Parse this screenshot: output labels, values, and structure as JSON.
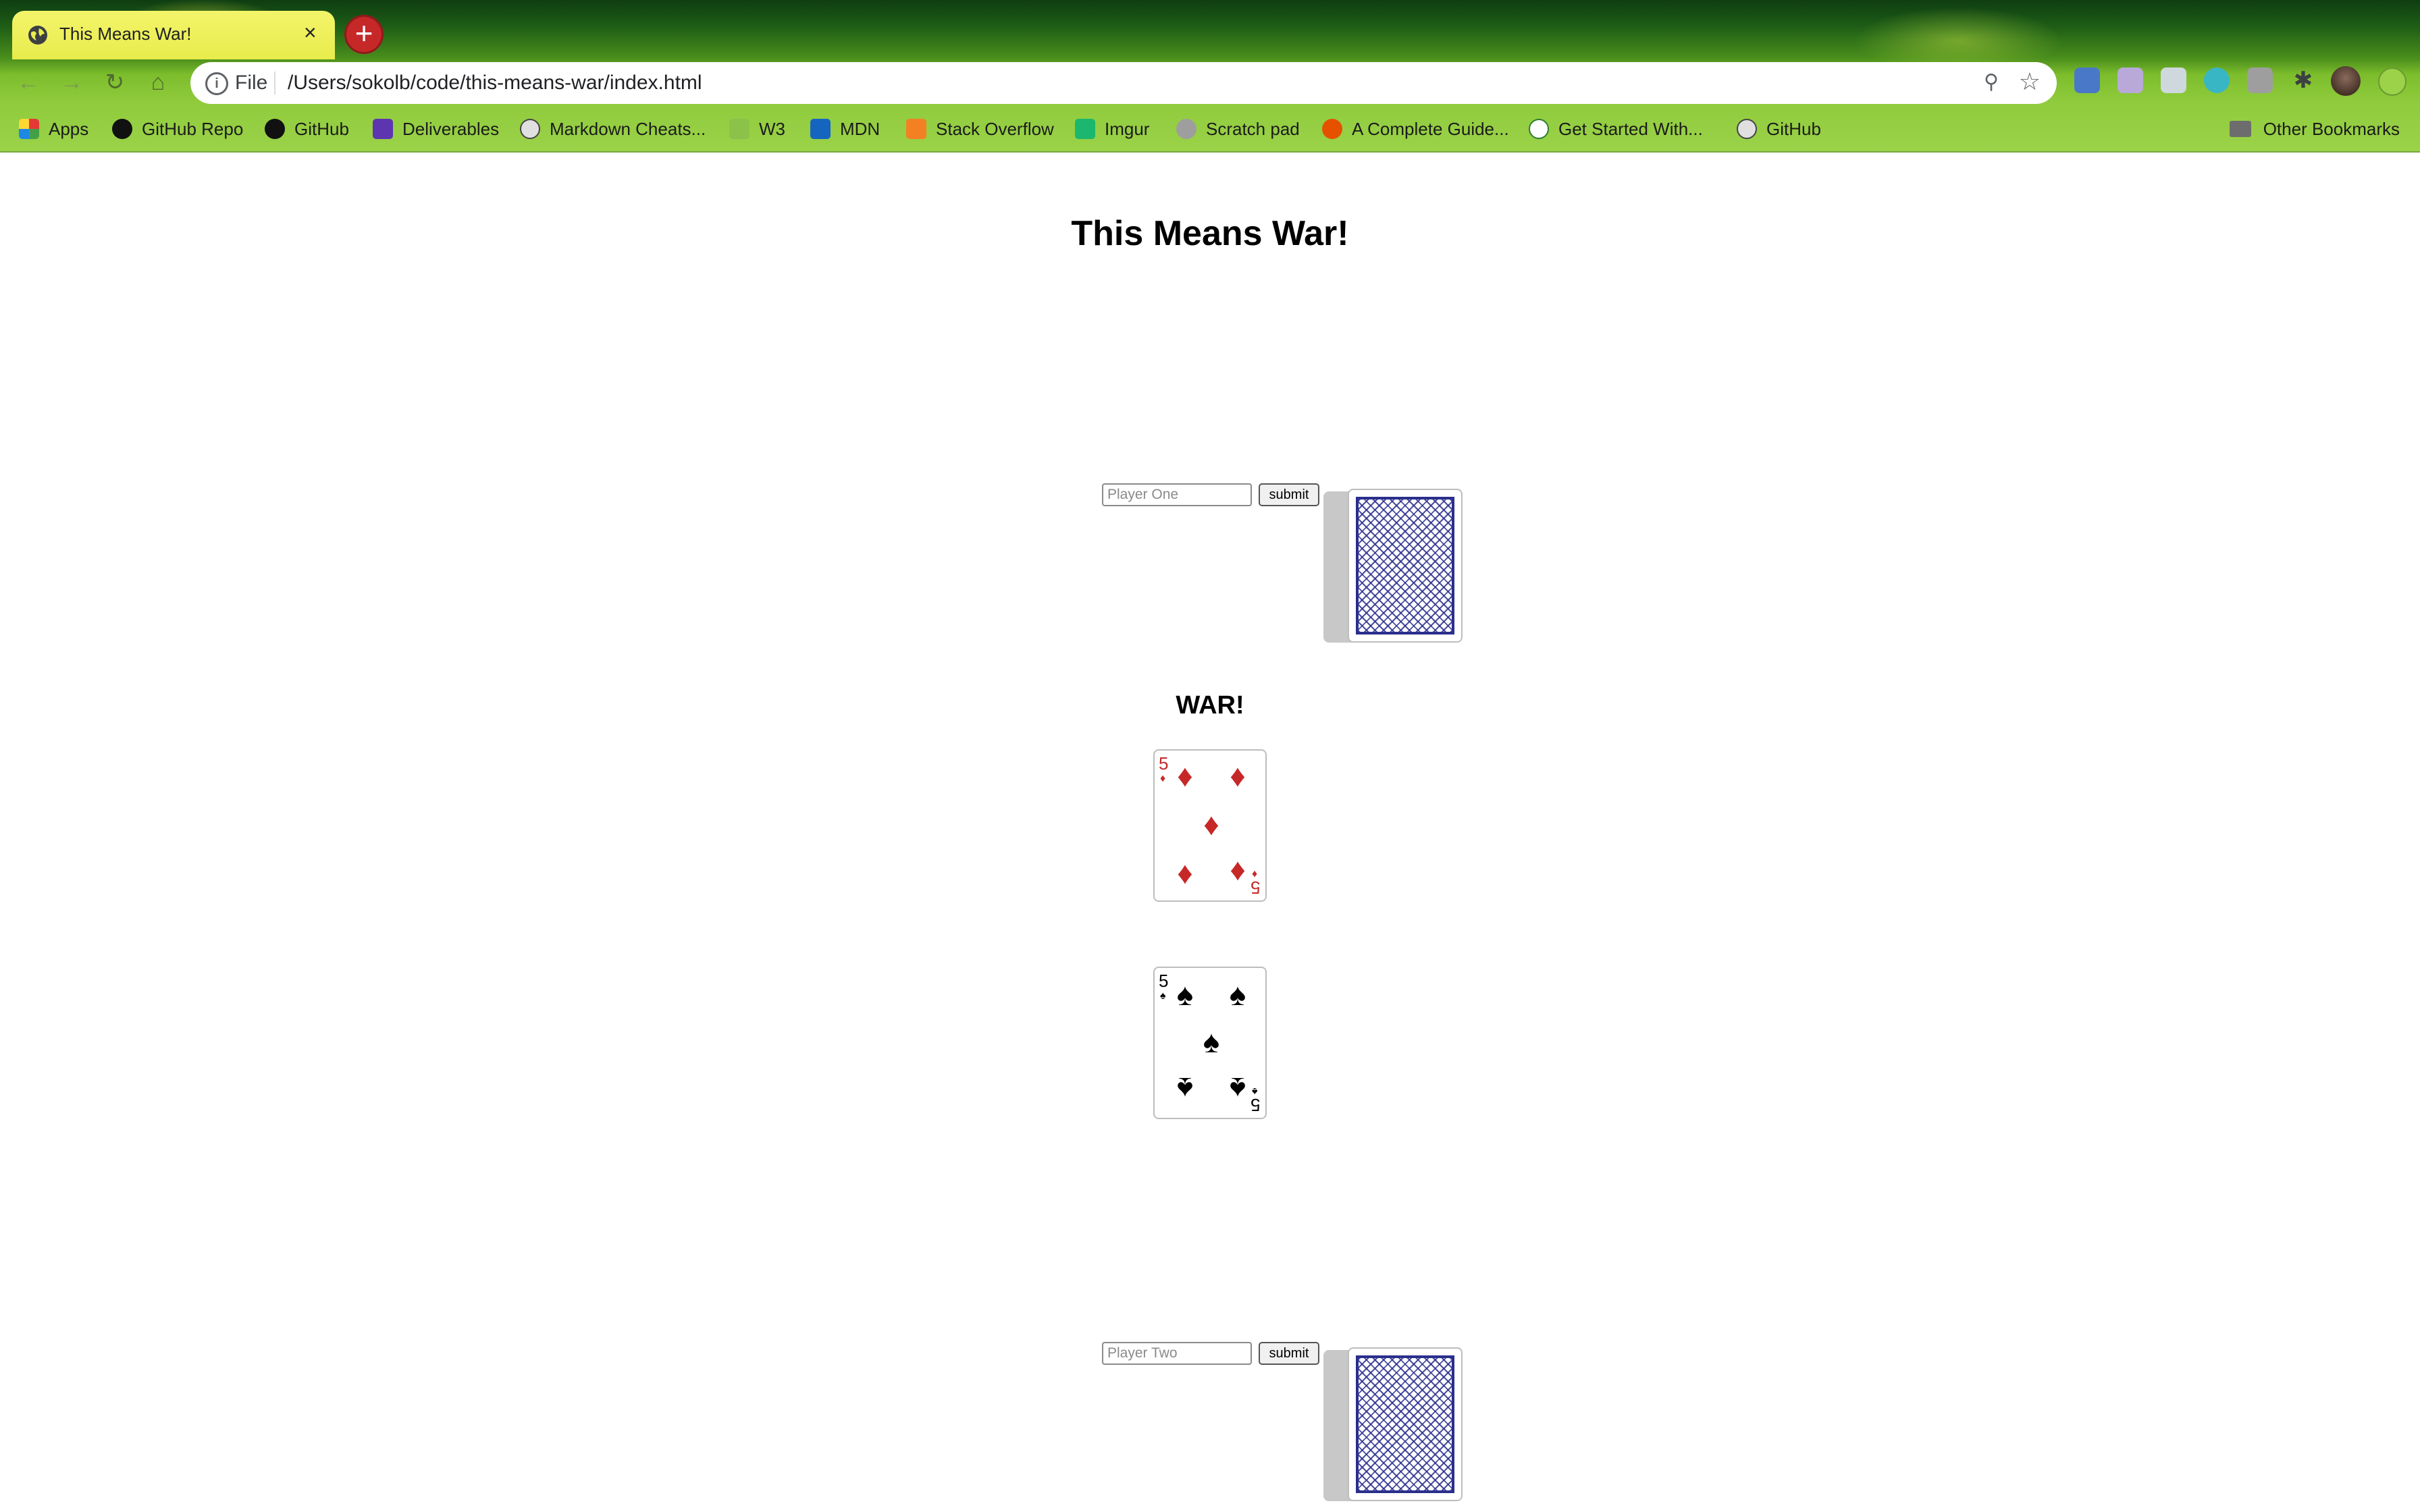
{
  "browser": {
    "tab_title": "This Means War!",
    "tab_close": "×",
    "new_tab": "+",
    "scheme_label": "File",
    "url": "/Users/sokolb/code/this-means-war/index.html",
    "bookmarks": [
      "Apps",
      "GitHub Repo",
      "GitHub",
      "Deliverables",
      "Markdown Cheats...",
      "W3",
      "MDN",
      "Stack Overflow",
      "Imgur",
      "Scratch pad",
      "A Complete Guide...",
      "Get Started With...",
      "GitHub"
    ],
    "other_bookmarks": "Other Bookmarks"
  },
  "page": {
    "title": "This Means War!",
    "war_label": "WAR!",
    "player_one": {
      "placeholder": "Player One",
      "submit": "submit"
    },
    "player_two": {
      "placeholder": "Player Two",
      "submit": "submit"
    },
    "cards": [
      {
        "rank": "5",
        "suit": "diamond",
        "suit_glyph": "♦",
        "color": "#c62828"
      },
      {
        "rank": "5",
        "suit": "spade",
        "suit_glyph": "♠",
        "color": "#000000"
      }
    ]
  }
}
